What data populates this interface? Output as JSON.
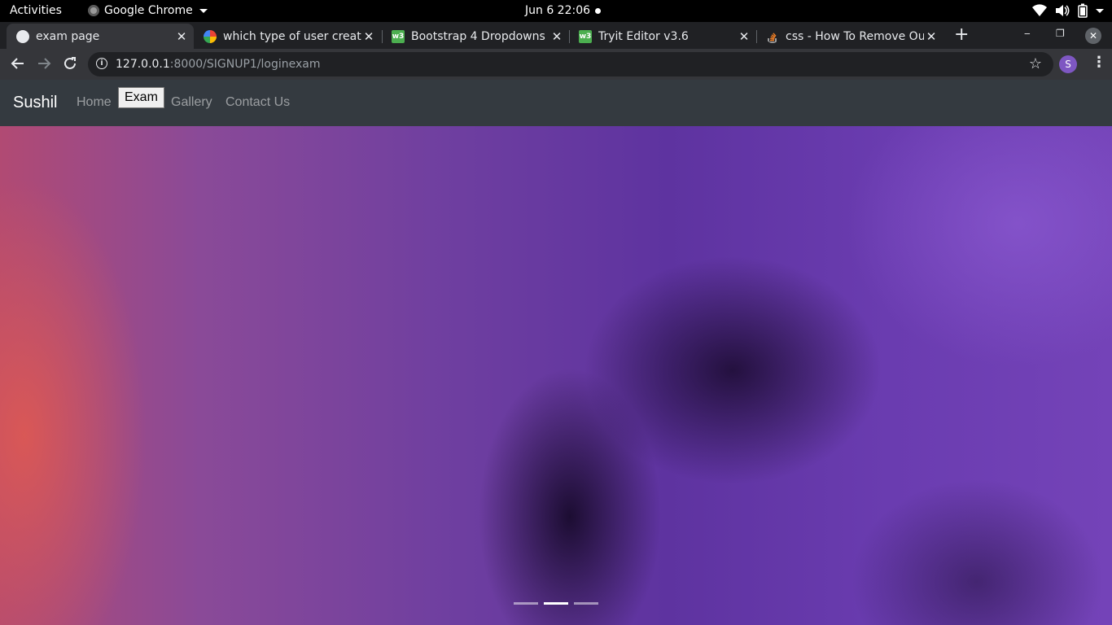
{
  "system_bar": {
    "activities": "Activities",
    "app_name": "Google Chrome",
    "datetime": "Jun 6  22:06"
  },
  "tabs": [
    {
      "title": "exam page",
      "favicon": "globe-icon",
      "active": true
    },
    {
      "title": "which type of user creat·",
      "favicon": "google-icon",
      "active": false
    },
    {
      "title": "Bootstrap 4 Dropdowns",
      "favicon": "w3schools-icon",
      "active": false
    },
    {
      "title": "Tryit Editor v3.6",
      "favicon": "w3schools-icon",
      "active": false
    },
    {
      "title": "css - How To Remove Ou",
      "favicon": "stackoverflow-icon",
      "active": false
    }
  ],
  "address_bar": {
    "host": "127.0.0.1",
    "path": ":8000/SIGNUP1/loginexam"
  },
  "profile_initial": "S",
  "navbar": {
    "brand": "Sushil",
    "links": [
      "Home",
      "Exam",
      "Gallery",
      "Contact Us"
    ],
    "active_index": 1
  },
  "carousel": {
    "slide_count": 3,
    "active_slide": 2
  },
  "colors": {
    "navbar_bg": "#343a40",
    "hero_purple": "#6a3cb0",
    "chrome_dark": "#202124"
  }
}
